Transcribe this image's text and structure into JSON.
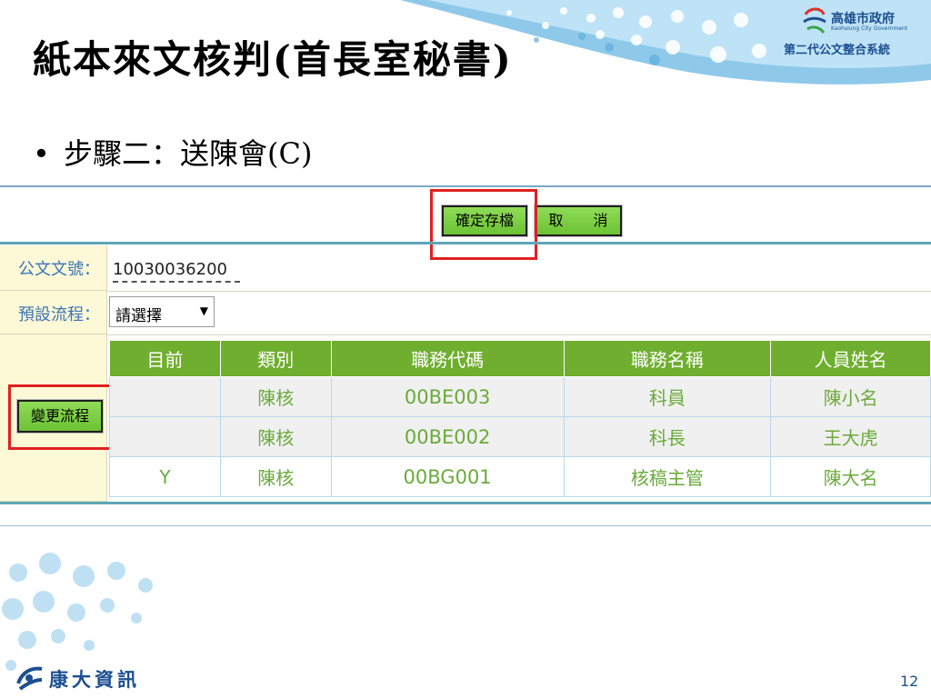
{
  "slide": {
    "title": "紙本來文核判(首長室秘書)",
    "bullet": "步驟二：送陳會(C)",
    "page_number": "12"
  },
  "header_logo": {
    "org_name": "高雄市政府",
    "org_name_en": "Kaohsiung City Government",
    "system_name": "第二代公文整合系統"
  },
  "footer_logo": {
    "company": "康大資訊"
  },
  "form": {
    "save_label": "確定存檔",
    "cancel_label": "取 消",
    "doc_no_label": "公文文號：",
    "doc_no_value": "10030036200",
    "default_flow_label": "預設流程：",
    "default_flow_selected": "請選擇",
    "change_flow_label": "變更流程",
    "table": {
      "headers": [
        "目前",
        "類別",
        "職務代碼",
        "職務名稱",
        "人員姓名"
      ],
      "rows": [
        [
          "",
          "陳核",
          "00BE003",
          "科員",
          "陳小名"
        ],
        [
          "",
          "陳核",
          "00BE002",
          "科長",
          "王大虎"
        ],
        [
          "Y",
          "陳核",
          "00BG001",
          "核稿主管",
          "陳大名"
        ]
      ]
    }
  },
  "colors": {
    "header_green": "#6fae2e",
    "button_green": "#7ccf44",
    "highlight_red": "#e02020",
    "label_blue": "#3a74b8",
    "label_bg": "#fdf9d6"
  }
}
